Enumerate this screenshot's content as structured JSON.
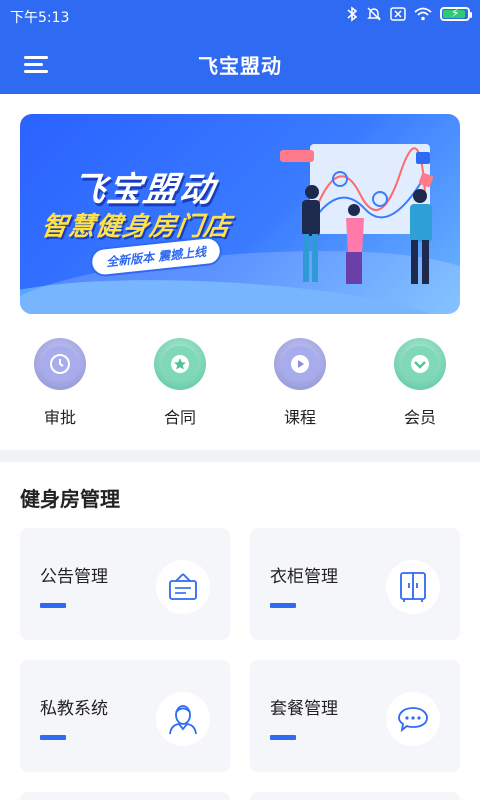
{
  "status": {
    "time": "下午5:13"
  },
  "header": {
    "title": "飞宝盟动"
  },
  "banner": {
    "title": "飞宝盟动",
    "subtitle": "智慧健身房门店",
    "tag": "全新版本 震撼上线"
  },
  "quick_actions": [
    {
      "label": "审批",
      "icon": "clock-icon",
      "color": "#8b8fd6"
    },
    {
      "label": "合同",
      "icon": "star-icon",
      "color": "#4fc39a"
    },
    {
      "label": "课程",
      "icon": "play-icon",
      "color": "#8b8fd6"
    },
    {
      "label": "会员",
      "icon": "chevron-down-icon",
      "color": "#4fc39a"
    }
  ],
  "section": {
    "title": "健身房管理",
    "cards": [
      {
        "label": "公告管理",
        "icon": "notice-board-icon"
      },
      {
        "label": "衣柜管理",
        "icon": "wardrobe-icon"
      },
      {
        "label": "私教系统",
        "icon": "trainer-icon"
      },
      {
        "label": "套餐管理",
        "icon": "chat-bubble-icon"
      }
    ]
  },
  "colors": {
    "primary": "#2f6af2",
    "card_bg": "#f5f6fa"
  }
}
